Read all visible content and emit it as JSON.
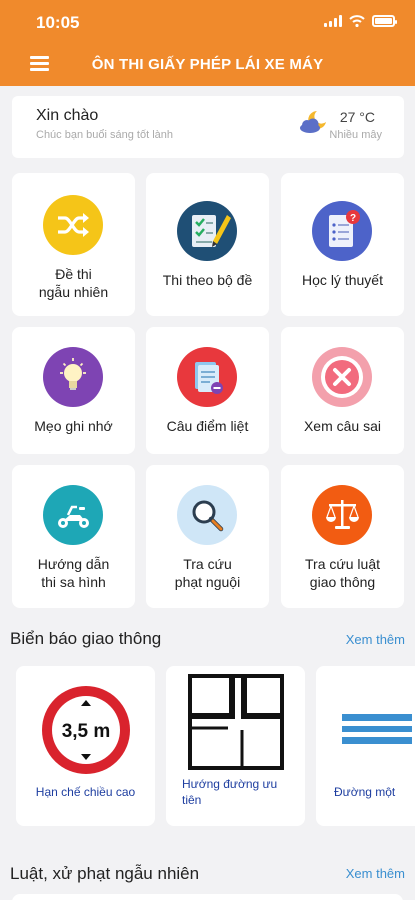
{
  "status": {
    "time": "10:05"
  },
  "header": {
    "title": "ÔN THI GIẤY PHÉP LÁI XE MÁY"
  },
  "greeting": {
    "title": "Xin chào",
    "subtitle": "Chúc bạn buổi sáng tốt lành",
    "temperature": "27 °C",
    "weather": "Nhiều mây",
    "weather_icon": "cloudy-night-icon"
  },
  "grid": [
    {
      "label": "Đề thi\nngẫu nhiên",
      "icon": "shuffle-icon",
      "color": "#f5c518"
    },
    {
      "label": "Thi theo bộ đề",
      "icon": "test-checklist-icon",
      "color": "#1f4f75"
    },
    {
      "label": "Học lý thuyết",
      "icon": "document-question-icon",
      "color": "#4d63c9"
    },
    {
      "label": "Mẹo ghi nhớ",
      "icon": "lightbulb-icon",
      "color": "#7e44b3"
    },
    {
      "label": "Câu điểm liệt",
      "icon": "document-minus-icon",
      "color": "#e8383d"
    },
    {
      "label": "Xem câu sai",
      "icon": "close-circle-icon",
      "color": "#f3a0ac"
    },
    {
      "label": "Hướng dẫn\nthi sa hình",
      "icon": "motorbike-icon",
      "color": "#1ea7b6"
    },
    {
      "label": "Tra cứu\nphạt nguội",
      "icon": "magnifier-icon",
      "color": "#cfe6f7"
    },
    {
      "label": "Tra cứu luật\ngiao thông",
      "icon": "scales-icon",
      "color": "#f25c12"
    }
  ],
  "signs": {
    "title": "Biển báo giao thông",
    "see_more": "Xem thêm",
    "items": [
      {
        "label": "Hạn chế chiều cao",
        "sign_text": "3,5 m",
        "icon": "height-limit-sign"
      },
      {
        "label": "Hướng đường ưu tiên",
        "icon": "priority-road-sign"
      },
      {
        "label": "Đường một",
        "icon": "one-way-sign"
      }
    ]
  },
  "laws": {
    "title": "Luật, xử phạt ngẫu nhiên",
    "see_more": "Xem thêm"
  }
}
